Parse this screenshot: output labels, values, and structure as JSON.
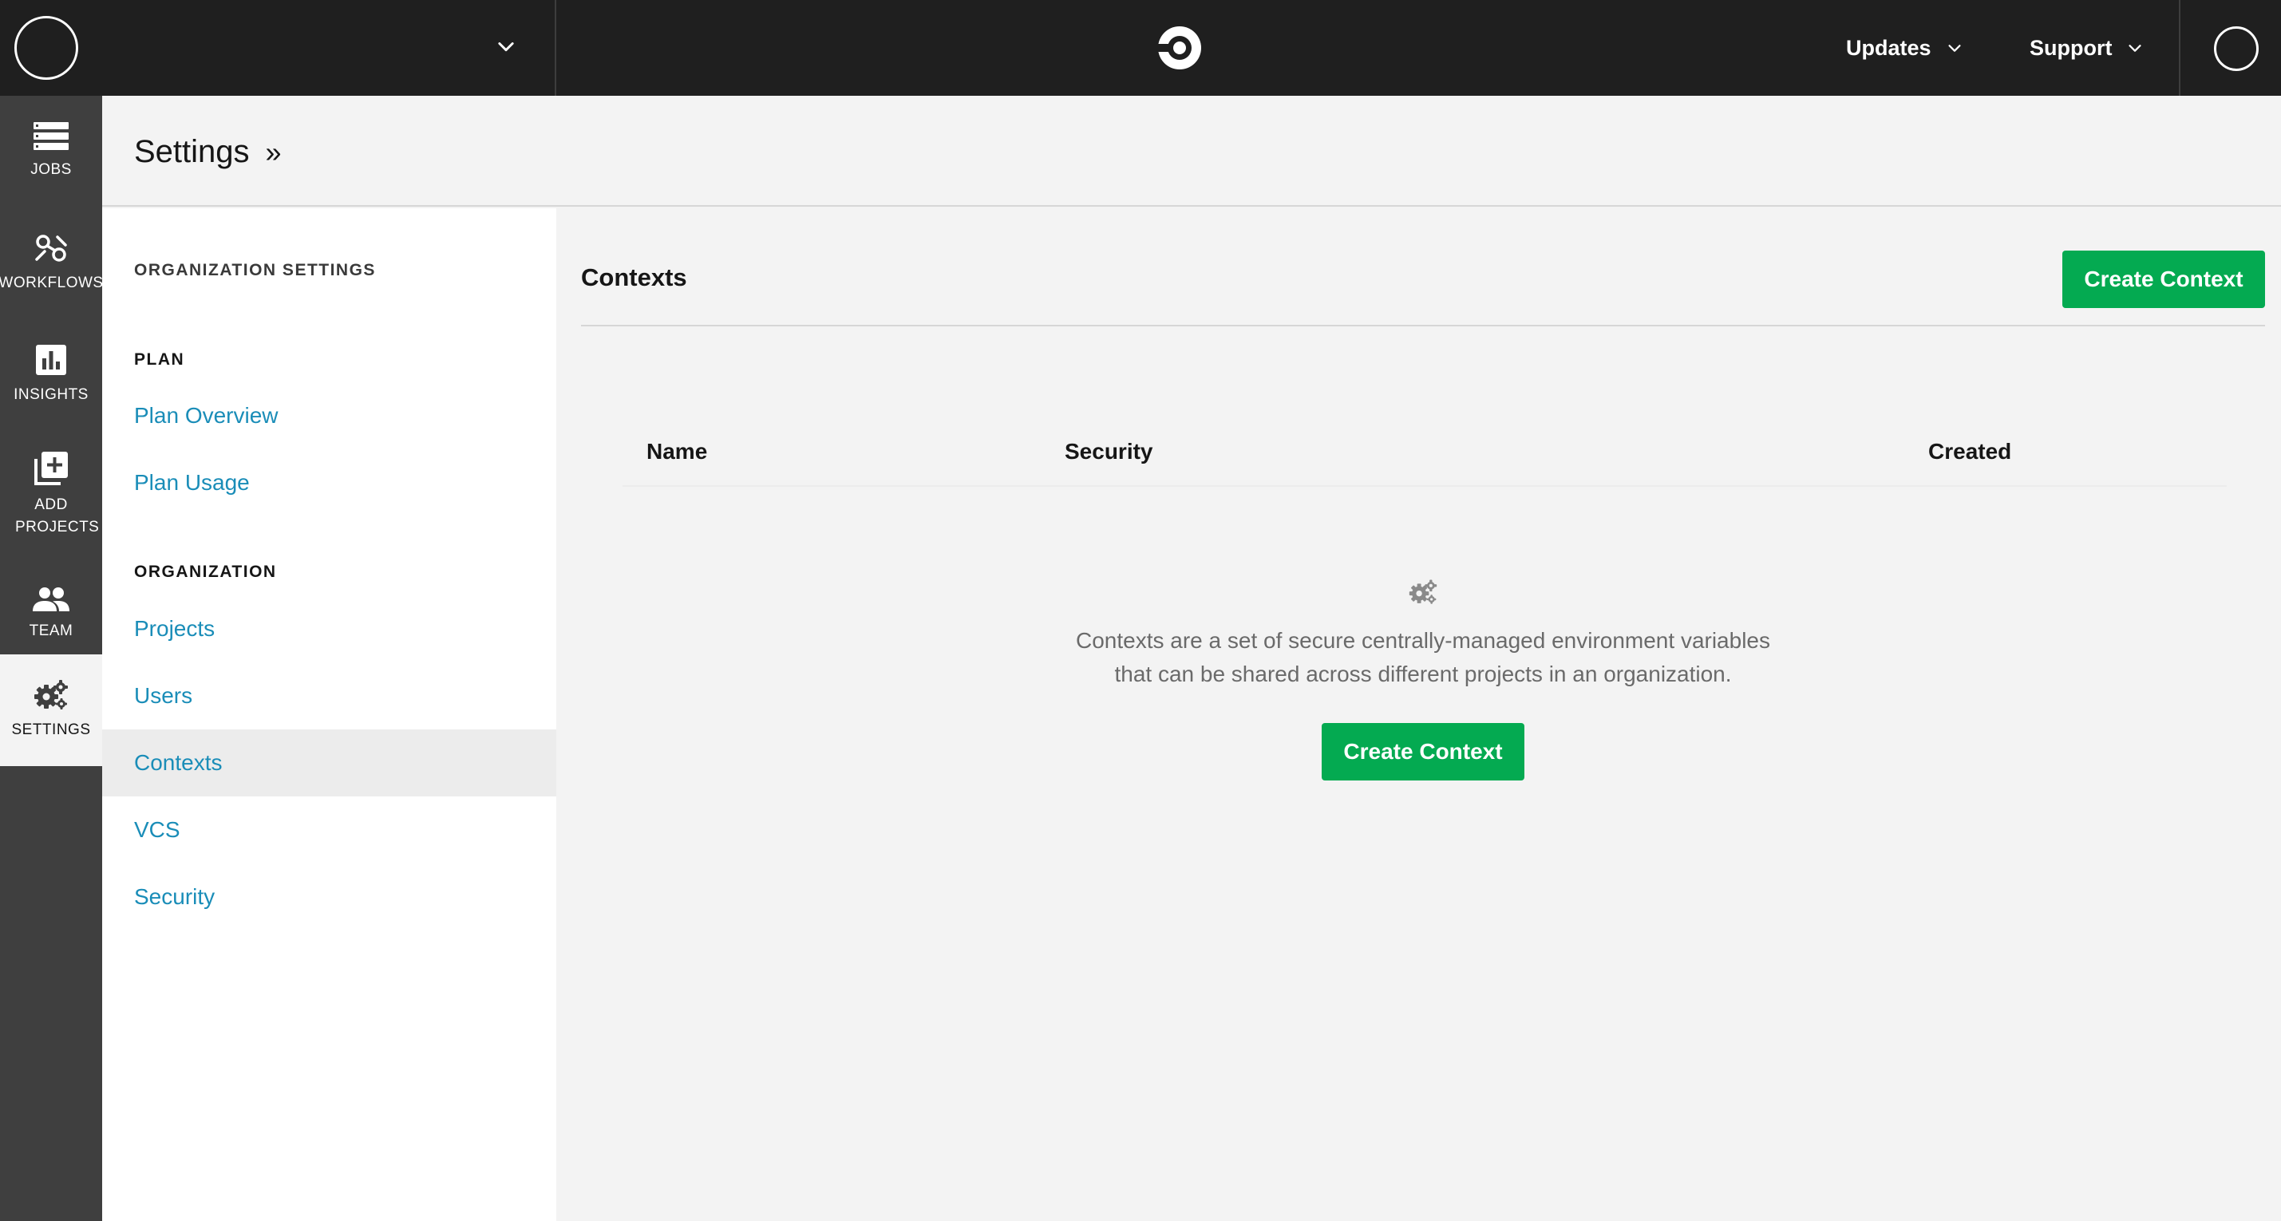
{
  "topbar": {
    "updates_label": "Updates",
    "support_label": "Support",
    "logo_icon": "circleci-logo-icon"
  },
  "nav": {
    "items": [
      {
        "label": "JOBS",
        "icon": "jobs-icon"
      },
      {
        "label": "WORKFLOWS",
        "icon": "workflows-icon"
      },
      {
        "label": "INSIGHTS",
        "icon": "insights-icon"
      },
      {
        "label": "ADD PROJECTS",
        "icon": "add-projects-icon"
      },
      {
        "label": "TEAM",
        "icon": "team-icon"
      },
      {
        "label": "SETTINGS",
        "icon": "gear-icon",
        "active": true
      }
    ]
  },
  "header": {
    "breadcrumb": "Settings",
    "separator": "»"
  },
  "settings_side": {
    "org_settings_heading": "ORGANIZATION SETTINGS",
    "plan_heading": "PLAN",
    "plan_links": [
      "Plan Overview",
      "Plan Usage"
    ],
    "organization_heading": "ORGANIZATION",
    "org_links": [
      "Projects",
      "Users",
      "Contexts",
      "VCS",
      "Security"
    ],
    "active_link": "Contexts"
  },
  "main": {
    "title": "Contexts",
    "create_button_label": "Create Context",
    "columns": [
      "Name",
      "Security",
      "Created"
    ],
    "empty_state": {
      "line1": "Contexts are a set of secure centrally-managed environment variables",
      "line2": "that can be shared across different projects in an organization.",
      "button_label": "Create Context"
    }
  },
  "colors": {
    "topbar_bg": "#1f1f1f",
    "leftnav_bg": "#3f3f3f",
    "link": "#1a8db8",
    "accent_green": "#04aa51"
  }
}
